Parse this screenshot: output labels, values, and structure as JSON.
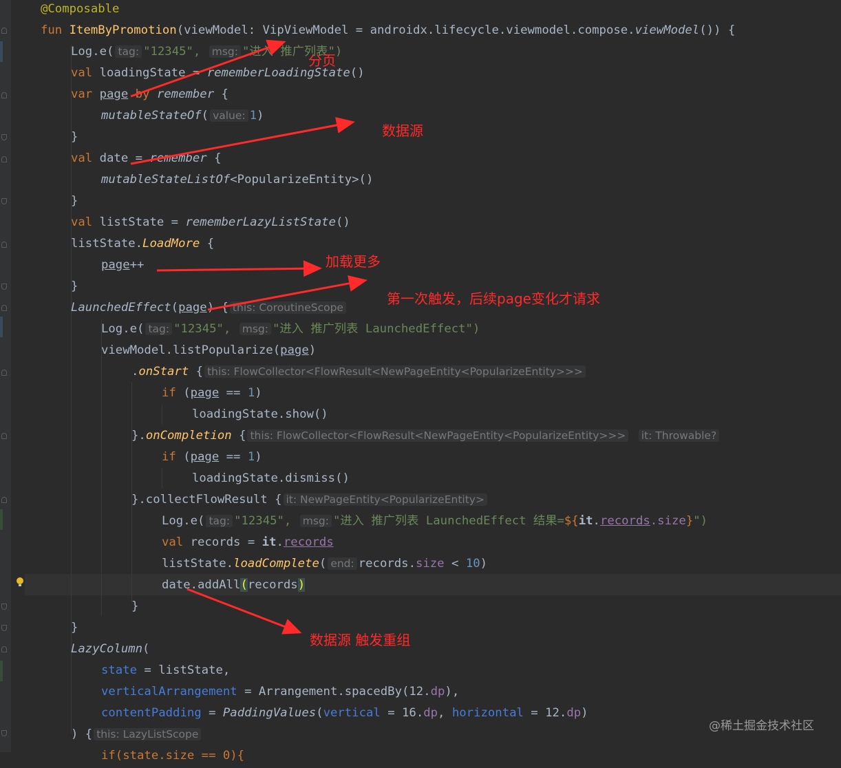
{
  "editor": {
    "annotation": "@Composable",
    "lines": {
      "l2_fun": "fun",
      "l2_name": "ItemByPromotion",
      "l2_params": "(viewModel: VipViewModel = androidx.lifecycle.viewmodel.compose.",
      "l2_viewModel": "viewModel",
      "l2_tail": "()) {",
      "log": "Log.e(",
      "tag_hint": "tag:",
      "tag_val": "\"12345\",",
      "msg_hint": "msg:",
      "l3_msg": "\"进入 推广列表\")",
      "val": "val",
      "var": "var",
      "l4_a": "loadingState = ",
      "l4_fn": "rememberLoadingState",
      "paren_close": "()",
      "l5_page": "page",
      "l5_by": "by",
      "l5_rem": "remember",
      "open_brace": "{",
      "close_brace": "}",
      "l6_fn": "mutableStateOf",
      "value_hint": "value:",
      "l6_one": "1",
      "paren_r": ")",
      "l8_date": "date = ",
      "l9_fn": "mutableStateListOf",
      "l9_tail": "<PopularizeEntity>()",
      "l11_a": "listState = ",
      "l11_fn": "rememberLazyListState",
      "l12_a": "listState.",
      "l12_fn": "LoadMore",
      "l13_page": "page",
      "l13_pp": "++",
      "l15_fn": "LaunchedEffect",
      "l15_paren": "(",
      "l15_tail": ") {",
      "this_coroutine": "this: CoroutineScope",
      "l16_msg": "\"进入 推广列表 LaunchedEffect\")",
      "l17_a": "viewModel.listPopularize(",
      "l18_dot": ".",
      "l18_fn": "onStart",
      "this_flow": "this: FlowCollector<FlowResult<NewPageEntity<PopularizeEntity>>>",
      "if": "if",
      "if_open": "(",
      "eq_one_a": " == ",
      "eq_one_b": ")",
      "l20": "loadingState.show()",
      "l21_a": "}.",
      "l21_fn": "onCompletion",
      "it_throw": "it: Throwable?",
      "l23": "loadingState.dismiss()",
      "l24_a": "}.collectFlowResult {",
      "it_npe": "it: NewPageEntity<PopularizeEntity>",
      "l25_msg": "\"进入 推广列表 LaunchedEffect 结果=",
      "l25_tmpl_open": "${",
      "l25_it": "it",
      "l25_dot": ".",
      "l25_records": "records",
      "l25_size": ".size",
      "l25_tmpl_close": "}",
      "l25_end": "\")",
      "l26_a": "records = ",
      "l26_it": "it",
      "l26_dot": ".",
      "l26_rec": "records",
      "l27_a": "listState.",
      "l27_fn": "loadComplete",
      "end_hint": "end:",
      "l27_b": "records.",
      "l27_size": "size",
      "l27_c": " < ",
      "l27_num": "10",
      "l28_a": "date.addAll",
      "l28_lp": "(",
      "l28_b": "records",
      "l28_rp": ")",
      "l31_fn": "LazyColumn",
      "l32_name": "state",
      "l32_b": " = listState,",
      "l33_name": "verticalArrangement",
      "l33_b": " = Arrangement.spacedBy(12.",
      "l33_dp": "dp",
      "l33_c": "),",
      "l34_name": "contentPadding",
      "l34_eq": " = ",
      "l34_fn": "PaddingValues",
      "l34_p": "(",
      "l34_vert": "vertical",
      "l34_b": " = 16.",
      "l34_c": ", ",
      "l34_hor": "horizontal",
      "l34_d": " = 12.",
      "l34_e": ")",
      "l35_a": ") {",
      "this_lazy": "this: LazyListScope",
      "l36": "if(state.size == 0){"
    }
  },
  "annotations": {
    "paging": "分页",
    "data_source": "数据源",
    "load_more": "加载更多",
    "first_trigger": "第一次触发，后续page变化才请求",
    "data_source_recompose": "数据源 触发重组"
  },
  "watermark": "@稀土掘金技术社区",
  "colors": {
    "background": "#2b2b2b",
    "keyword": "#cc7832",
    "function": "#ffc66d",
    "string": "#6a8759",
    "number": "#6897bb",
    "property": "#9876aa",
    "annotation_red": "#ff2a2a"
  }
}
